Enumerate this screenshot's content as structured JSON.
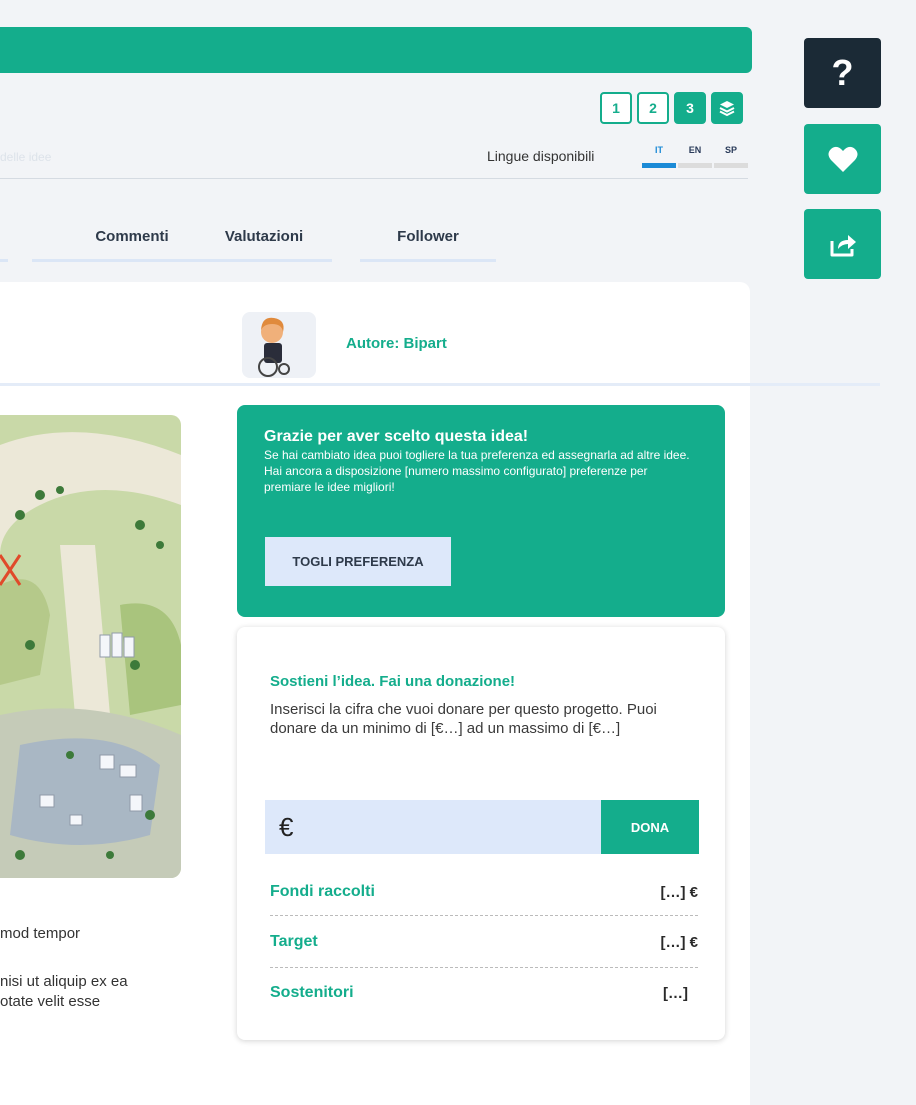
{
  "steps": [
    "1",
    "2",
    "3"
  ],
  "faded_text": "delle idee",
  "languages": {
    "label": "Lingue disponibili",
    "items": [
      "IT",
      "EN",
      "SP"
    ]
  },
  "tabs": [
    "Commenti",
    "Valutazioni",
    "Follower"
  ],
  "author": "Autore: Bipart",
  "thanks": {
    "title": "Grazie per aver scelto questa idea!",
    "line1": "Se hai cambiato idea puoi togliere la tua preferenza ed assegnarla ad altre idee.",
    "line2": "Hai ancora a disposizione [numero massimo configurato] preferenze per premiare le idee migliori!",
    "button": "TOGLI PREFERENZA"
  },
  "donation": {
    "title": "Sostieni l’idea. Fai una donazione!",
    "description": "Inserisci la cifra che vuoi donare per questo progetto. Puoi donare da un minimo di [€…] ad un massimo di [€…]",
    "currency": "€",
    "button": "DONA",
    "stats": [
      {
        "label": "Fondi raccolti",
        "value": "[…] €"
      },
      {
        "label": "Target",
        "value": "[…] €"
      },
      {
        "label": "Sostenitori",
        "value": "[…]"
      }
    ]
  },
  "body_text": [
    "mod tempor",
    "nisi ut aliquip ex ea",
    "otate velit esse"
  ],
  "colors": {
    "primary": "#14ad8c",
    "dark": "#1b2a36",
    "light_blue": "#dde8fa",
    "active_lang": "#1b8ad6"
  },
  "icons": [
    "layers-icon",
    "help-icon",
    "heart-icon",
    "share-icon"
  ]
}
